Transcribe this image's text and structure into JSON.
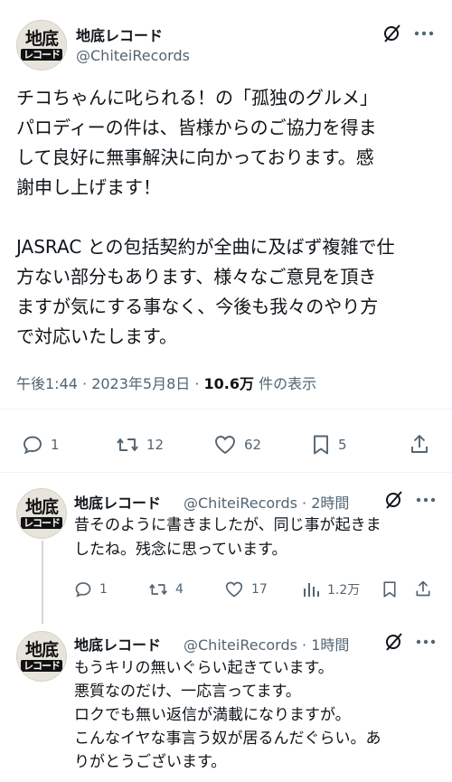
{
  "main_tweet": {
    "avatar": {
      "line1": "地底",
      "line2": "レコード"
    },
    "author_name": "地底レコード",
    "author_handle": "@ChiteiRecords",
    "text": "チコちゃんに叱られる！の「孤独のグルメ」\nパロディーの件は、皆様からのご協力を得ま\nして良好に無事解決に向かっております。感\n謝申し上げます！\n\nJASRAC との包括契約が全曲に及ばず複雑で仕\n方ない部分もあります、様々なご意見を頂き\nますが気にする事なく、今後も我々のやり方\nで対応いたします。",
    "timestamp": "午後1:44 · 2023年5月8日 · ",
    "views_count": "10.6万",
    "views_label": " 件の表示",
    "stats": {
      "replies": "1",
      "retweets": "12",
      "likes": "62",
      "bookmarks": "5"
    }
  },
  "replies": [
    {
      "avatar": {
        "line1": "地底",
        "line2": "レコード"
      },
      "author_name": "地底レコード",
      "author_handle": "@ChiteiRecords · 2時間",
      "text": "昔そのように書きましたが、同じ事が起きま\nしたね。残念に思っています。",
      "stats": {
        "replies": "1",
        "retweets": "4",
        "likes": "17",
        "views": "1.2万"
      }
    },
    {
      "avatar": {
        "line1": "地底",
        "line2": "レコード"
      },
      "author_name": "地底レコード",
      "author_handle": "@ChiteiRecords · 1時間",
      "text": "もうキリの無いぐらい起きています。\n悪質なのだけ、一応言ってます。\nロクでも無い返信が満載になりますが。\nこんなイヤな事言う奴が居るんだぐらい。あ\nりがとうございます。"
    }
  ],
  "icons": {
    "grok": "grok-slash-icon",
    "more": "more-dots-icon",
    "reply": "reply-bubble-icon",
    "retweet": "retweet-icon",
    "like": "heart-icon",
    "bookmark": "bookmark-icon",
    "share": "share-icon",
    "views": "views-bars-icon"
  },
  "colors": {
    "text": "#0f1419",
    "secondary": "#536471",
    "divider": "#eff3f4"
  }
}
